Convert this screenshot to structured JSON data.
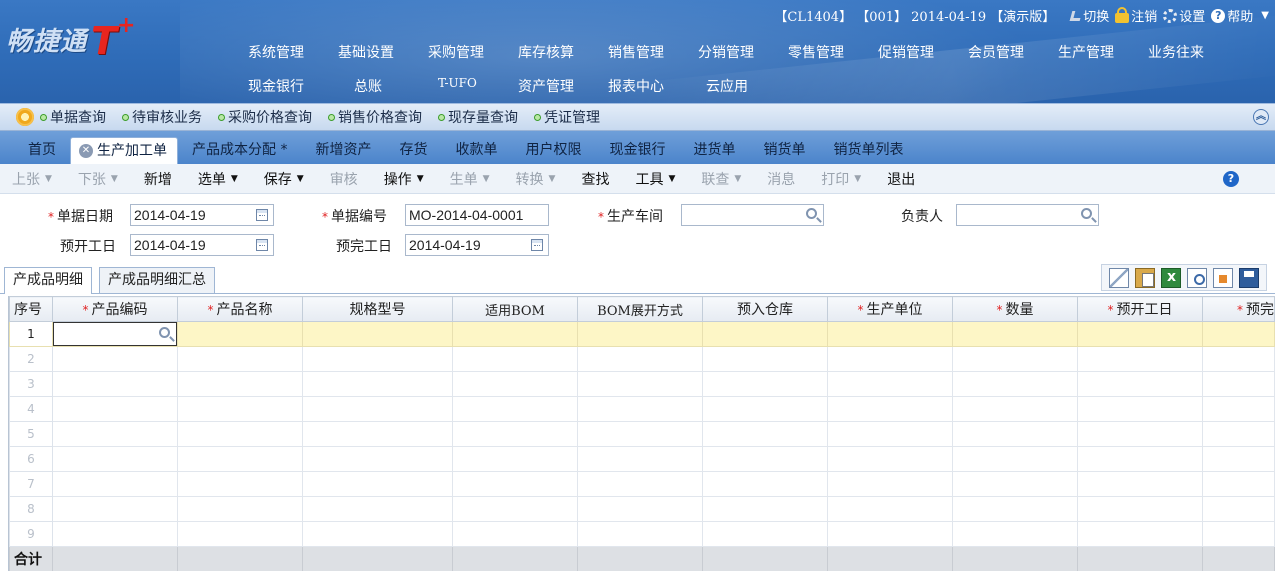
{
  "header": {
    "logo_text": "畅捷通",
    "logo_brand": "T",
    "logo_plus": "+",
    "account_info": "【CL1404】 【001】 2014-04-19 【演示版】",
    "actions": {
      "switch": "切换",
      "logout": "注销",
      "settings": "设置",
      "help": "帮助"
    },
    "menu_row1": [
      "系统管理",
      "基础设置",
      "采购管理",
      "库存核算",
      "销售管理",
      "分销管理",
      "零售管理",
      "促销管理",
      "会员管理",
      "生产管理",
      "业务往来"
    ],
    "menu_row2": [
      "现金银行",
      "总账",
      "T-UFO",
      "资产管理",
      "报表中心",
      "云应用"
    ]
  },
  "quickbar": {
    "items": [
      "单据查询",
      "待审核业务",
      "采购价格查询",
      "销售价格查询",
      "现存量查询",
      "凭证管理"
    ]
  },
  "tabs": [
    "首页",
    "生产加工单",
    "产品成本分配 *",
    "新增资产",
    "存货",
    "收款单",
    "用户权限",
    "现金银行",
    "进货单",
    "销货单",
    "销货单列表"
  ],
  "toolbar": {
    "prev": "上张",
    "next": "下张",
    "new": "新增",
    "select": "选单",
    "save": "保存",
    "audit": "审核",
    "operate": "操作",
    "gen": "生单",
    "convert": "转换",
    "find": "查找",
    "tools": "工具",
    "link": "联查",
    "message": "消息",
    "print": "打印",
    "exit": "退出"
  },
  "form": {
    "doc_date_label": "单据日期",
    "doc_date": "2014-04-19",
    "doc_no_label": "单据编号",
    "doc_no": "MO-2014-04-0001",
    "workshop_label": "生产车间",
    "workshop": "",
    "owner_label": "负责人",
    "owner": "",
    "plan_start_label": "预开工日",
    "plan_start": "2014-04-19",
    "plan_end_label": "预完工日",
    "plan_end": "2014-04-19"
  },
  "detail_tabs": [
    "产成品明细",
    "产成品明细汇总"
  ],
  "grid": {
    "columns": [
      "序号",
      "产品编码",
      "产品名称",
      "规格型号",
      "适用BOM",
      "BOM展开方式",
      "预入仓库",
      "生产单位",
      "数量",
      "预开工日",
      "预完"
    ],
    "required": [
      false,
      true,
      true,
      false,
      false,
      false,
      false,
      true,
      true,
      true,
      true
    ],
    "row_numbers": [
      "1",
      "2",
      "3",
      "4",
      "5",
      "6",
      "7",
      "8",
      "9"
    ],
    "total_label": "合计"
  },
  "colors": {
    "header_blue": "#2f6cb8",
    "tab_blue": "#4b84cb",
    "highlight_row": "#fdf6c6",
    "required_star": "#e02020"
  }
}
